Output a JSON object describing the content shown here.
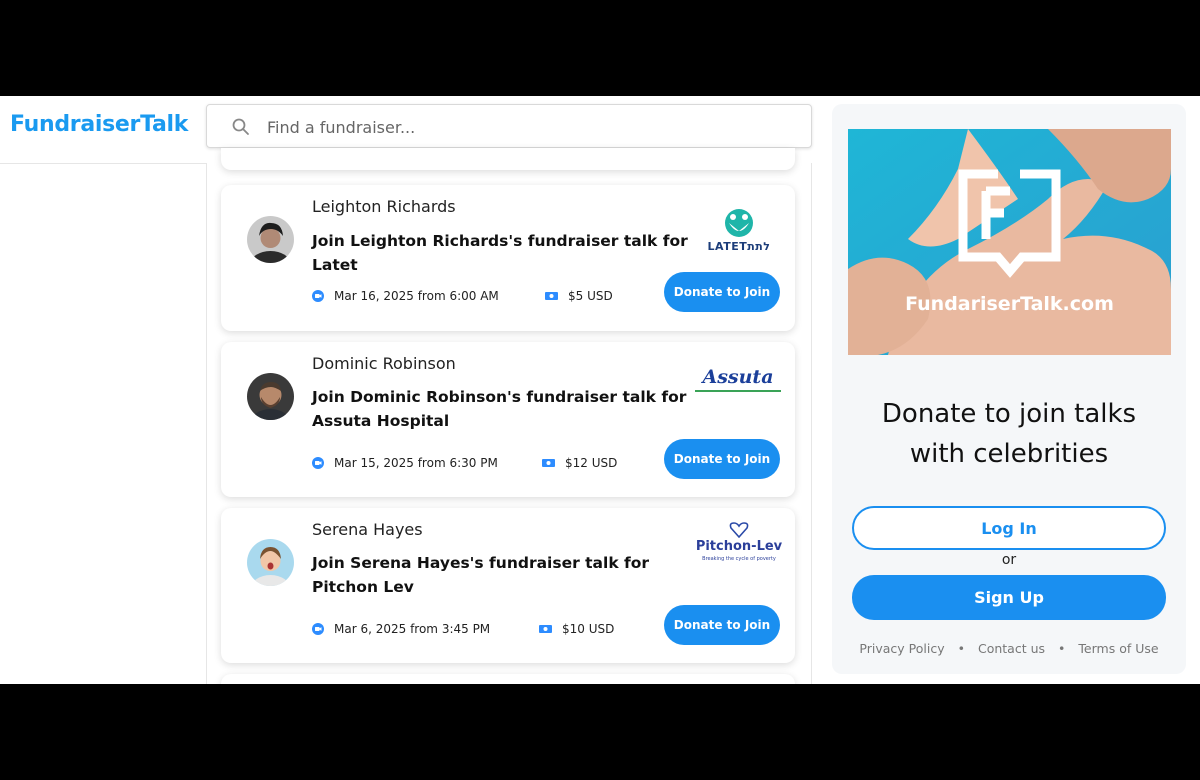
{
  "brand": "FundraiserTalk",
  "search": {
    "placeholder": "Find a fundraiser...",
    "value": ""
  },
  "cards": [
    {
      "host": "Leighton Richards",
      "title": "Join Leighton Richards's fundraiser talk for Latet",
      "datetime": "Mar 16, 2025 from 6:00 AM",
      "price": "$5 USD",
      "button": "Donate to Join",
      "logo_text": "LATETלתת"
    },
    {
      "host": "Dominic Robinson",
      "title": "Join Dominic Robinson's fundraiser talk for Assuta Hospital",
      "datetime": "Mar 15, 2025 from 6:30 PM",
      "price": "$12 USD",
      "button": "Donate to Join",
      "logo_text": "Assuta"
    },
    {
      "host": "Serena Hayes",
      "title": "Join Serena Hayes's fundraiser talk for Pitchon Lev",
      "datetime": "Mar 6, 2025 from 3:45 PM",
      "price": "$10 USD",
      "button": "Donate to Join",
      "logo_text": "Pitchon-Lev",
      "logo_subtext": "Breaking the cycle of poverty"
    }
  ],
  "panel": {
    "hero_caption": "FundariserTalk.com",
    "tagline_line1": "Donate to join talks",
    "tagline_line2": "with celebrities",
    "login": "Log In",
    "or": "or",
    "signup": "Sign Up",
    "footer": [
      "Privacy Policy",
      "Contact us",
      "Terms of Use"
    ]
  },
  "colors": {
    "accent": "#1a8ff0",
    "brand": "#1a9af0",
    "panel_bg": "#f5f7f9"
  },
  "icons": [
    "search-icon",
    "video-call-icon",
    "money-icon"
  ]
}
